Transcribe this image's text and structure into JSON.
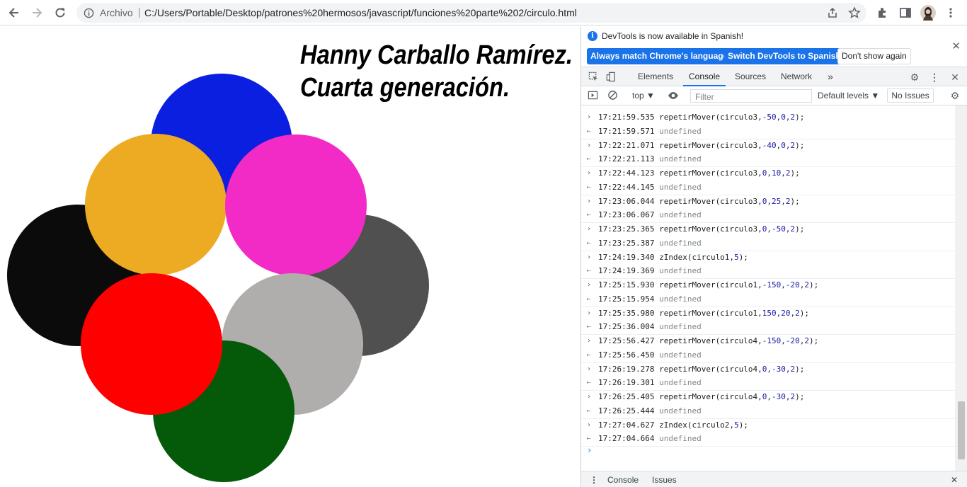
{
  "browser": {
    "scheme_label": "Archivo",
    "url": "C:/Users/Portable/Desktop/patrones%20hermosos/javascript/funciones%20parte%202/circulo.html",
    "icons": [
      "back-icon",
      "forward-icon",
      "reload-icon",
      "info-icon",
      "share-icon",
      "star-icon",
      "extensions-icon",
      "sidepanel-icon",
      "avatar",
      "menu-icon"
    ]
  },
  "page": {
    "title_line1": "Hanny Carballo Ramírez.",
    "title_line2": "Cuarta generación.",
    "circle_colors": {
      "blue": "#0b1fe0",
      "black": "#0b0b0b",
      "dark_gray": "#515051",
      "orange": "#ecab22",
      "magenta": "#f32bc6",
      "light_gray": "#b0adad",
      "red": "#ff0000",
      "green": "#045a09"
    }
  },
  "devtools": {
    "info": {
      "message": "DevTools is now available in Spanish!",
      "btn_match": "Always match Chrome's language",
      "btn_switch": "Switch DevTools to Spanish",
      "btn_dismiss": "Don't show again"
    },
    "tabs": {
      "elements": "Elements",
      "console": "Console",
      "sources": "Sources",
      "network": "Network",
      "more": "»"
    },
    "toolbar": {
      "context": "top ▼",
      "filter_placeholder": "Filter",
      "levels": "Default levels ▼",
      "issues": "No Issues"
    },
    "drawer": {
      "console": "Console",
      "issues": "Issues"
    },
    "console_lines": [
      {
        "kind": "in",
        "ts": "17:21:59.535",
        "fn": "repetirMover(circulo3,",
        "args": [
          "-50",
          "0",
          "2"
        ]
      },
      {
        "kind": "out",
        "ts": "17:21:59.571",
        "text": "undefined"
      },
      {
        "kind": "in",
        "ts": "17:22:21.071",
        "fn": "repetirMover(circulo3,",
        "args": [
          "-40",
          "0",
          "2"
        ]
      },
      {
        "kind": "out",
        "ts": "17:22:21.113",
        "text": "undefined"
      },
      {
        "kind": "in",
        "ts": "17:22:44.123",
        "fn": "repetirMover(circulo3,",
        "args": [
          "0",
          "10",
          "2"
        ]
      },
      {
        "kind": "out",
        "ts": "17:22:44.145",
        "text": "undefined"
      },
      {
        "kind": "in",
        "ts": "17:23:06.044",
        "fn": "repetirMover(circulo3,",
        "args": [
          "0",
          "25",
          "2"
        ]
      },
      {
        "kind": "out",
        "ts": "17:23:06.067",
        "text": "undefined"
      },
      {
        "kind": "in",
        "ts": "17:23:25.365",
        "fn": "repetirMover(circulo3,",
        "args": [
          "0",
          "-50",
          "2"
        ]
      },
      {
        "kind": "out",
        "ts": "17:23:25.387",
        "text": "undefined"
      },
      {
        "kind": "in",
        "ts": "17:24:19.340",
        "fn": "zIndex(circulo1,",
        "args": [
          "5"
        ]
      },
      {
        "kind": "out",
        "ts": "17:24:19.369",
        "text": "undefined"
      },
      {
        "kind": "in",
        "ts": "17:25:15.930",
        "fn": "repetirMover(circulo1,",
        "args": [
          "-150",
          "-20",
          "2"
        ]
      },
      {
        "kind": "out",
        "ts": "17:25:15.954",
        "text": "undefined"
      },
      {
        "kind": "in",
        "ts": "17:25:35.980",
        "fn": "repetirMover(circulo1,",
        "args": [
          "150",
          "20",
          "2"
        ]
      },
      {
        "kind": "out",
        "ts": "17:25:36.004",
        "text": "undefined"
      },
      {
        "kind": "in",
        "ts": "17:25:56.427",
        "fn": "repetirMover(circulo4,",
        "args": [
          "-150",
          "-20",
          "2"
        ]
      },
      {
        "kind": "out",
        "ts": "17:25:56.450",
        "text": "undefined"
      },
      {
        "kind": "in",
        "ts": "17:26:19.278",
        "fn": "repetirMover(circulo4,",
        "args": [
          "0",
          "-30",
          "2"
        ]
      },
      {
        "kind": "out",
        "ts": "17:26:19.301",
        "text": "undefined"
      },
      {
        "kind": "in",
        "ts": "17:26:25.405",
        "fn": "repetirMover(circulo4,",
        "args": [
          "0",
          "-30",
          "2"
        ]
      },
      {
        "kind": "out",
        "ts": "17:26:25.444",
        "text": "undefined"
      },
      {
        "kind": "in",
        "ts": "17:27:04.627",
        "fn": "zIndex(circulo2,",
        "args": [
          "5"
        ]
      },
      {
        "kind": "out",
        "ts": "17:27:04.664",
        "text": "undefined"
      }
    ]
  }
}
